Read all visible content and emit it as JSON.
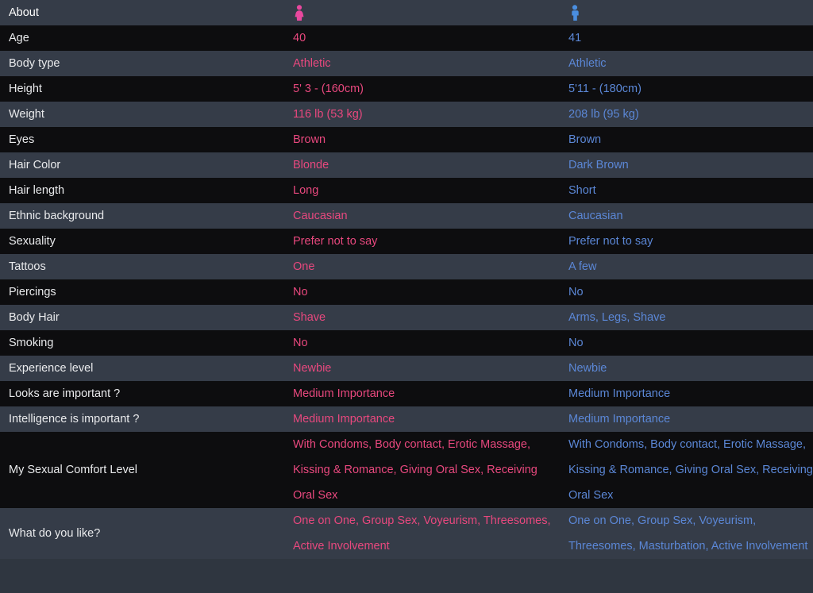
{
  "header": {
    "title": "About",
    "female_icon": "female-figure-icon",
    "male_icon": "male-figure-icon",
    "female_color": "#e8487e",
    "male_color": "#5b87d6"
  },
  "colors": {
    "row_dark": "#0d0d0f",
    "row_light": "#353c48",
    "label_text": "#e9eaec",
    "female_value": "#e8487e",
    "male_value": "#5b87d6",
    "page_background": "#2f3640"
  },
  "table": {
    "columns": [
      "About",
      "female",
      "male"
    ],
    "rows": [
      {
        "label": "Age",
        "female": "40",
        "male": "41"
      },
      {
        "label": "Body type",
        "female": "Athletic",
        "male": "Athletic"
      },
      {
        "label": "Height",
        "female": "5' 3 - (160cm)",
        "male": "5'11 - (180cm)"
      },
      {
        "label": "Weight",
        "female": "116 lb (53 kg)",
        "male": "208 lb (95 kg)"
      },
      {
        "label": "Eyes",
        "female": "Brown",
        "male": "Brown"
      },
      {
        "label": "Hair Color",
        "female": "Blonde",
        "male": "Dark Brown"
      },
      {
        "label": "Hair length",
        "female": "Long",
        "male": "Short"
      },
      {
        "label": "Ethnic background",
        "female": "Caucasian",
        "male": "Caucasian"
      },
      {
        "label": "Sexuality",
        "female": "Prefer not to say",
        "male": "Prefer not to say"
      },
      {
        "label": "Tattoos",
        "female": "One",
        "male": "A few"
      },
      {
        "label": "Piercings",
        "female": "No",
        "male": "No"
      },
      {
        "label": "Body Hair",
        "female": "Shave",
        "male": "Arms, Legs, Shave"
      },
      {
        "label": "Smoking",
        "female": "No",
        "male": "No"
      },
      {
        "label": "Experience level",
        "female": "Newbie",
        "male": "Newbie"
      },
      {
        "label": "Looks are important ?",
        "female": "Medium Importance",
        "male": "Medium Importance"
      },
      {
        "label": "Intelligence is important ?",
        "female": "Medium Importance",
        "male": "Medium Importance"
      },
      {
        "label": "My Sexual Comfort Level",
        "female": "With Condoms, Body contact, Erotic Massage, Kissing & Romance, Giving Oral Sex, Receiving Oral Sex",
        "male": "With Condoms, Body contact, Erotic Massage, Kissing & Romance, Giving Oral Sex, Receiving Oral Sex"
      },
      {
        "label": "What do you like?",
        "female": "One on One, Group Sex, Voyeurism, Threesomes, Active Involvement",
        "male": "One on One, Group Sex, Voyeurism, Threesomes, Masturbation, Active Involvement"
      }
    ]
  }
}
